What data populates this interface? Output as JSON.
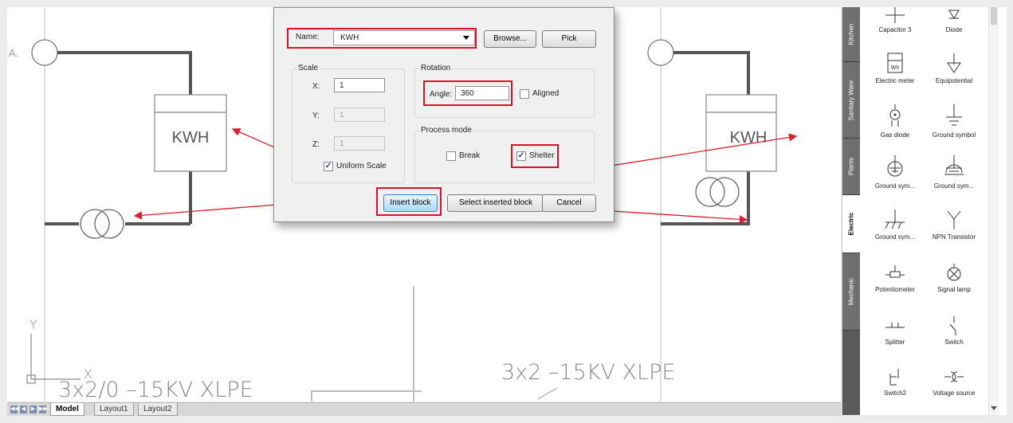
{
  "canvas": {
    "left_cable_label": "3x2/0 –15KV XLPE",
    "right_cable_label": "3x2 –15KV XLPE",
    "meter_label": "KWH",
    "axis_y": "Y",
    "axis_x": "X",
    "edge_letter": "A."
  },
  "layout_tabs": {
    "nav": [
      "◀◀",
      "◀",
      "▶",
      "▶▶"
    ],
    "tabs": [
      "Model",
      "Layout1",
      "Layout2"
    ],
    "active": "Model"
  },
  "dialog": {
    "name_label": "Name:",
    "name_value": "KWH",
    "browse_label": "Browse...",
    "pick_label": "Pick",
    "scale": {
      "title": "Scale",
      "x_label": "X:",
      "x_value": "1",
      "y_label": "Y:",
      "y_value": "1",
      "z_label": "Z:",
      "z_value": "1",
      "uniform_label": "Uniform Scale",
      "uniform_checked": true
    },
    "rotation": {
      "title": "Rotation",
      "angle_label": "Angle:",
      "angle_value": "360",
      "aligned_label": "Aligned",
      "aligned_checked": false
    },
    "process": {
      "title": "Process mode",
      "break_label": "Break",
      "break_checked": false,
      "shelter_label": "Shelter",
      "shelter_checked": true
    },
    "insert_label": "Insert block",
    "select_label": "Select inserted block",
    "cancel_label": "Cancel",
    "highlight_color": "#e0102a"
  },
  "palette": {
    "tabs": [
      "Kitchen",
      "Sanitary Ware",
      "Plants",
      "Electric",
      "Mechanic"
    ],
    "active_tab": "Electric",
    "items": [
      {
        "label": "Capacitor 3",
        "icon": "capacitor-icon"
      },
      {
        "label": "Diode",
        "icon": "diode-icon"
      },
      {
        "label": "Electric meter",
        "icon": "electric-meter-icon",
        "glyph": "Wh"
      },
      {
        "label": "Equipotential",
        "icon": "equipotential-icon"
      },
      {
        "label": "Gas diode",
        "icon": "gas-diode-icon"
      },
      {
        "label": "Ground symbol",
        "icon": "ground-symbol-icon"
      },
      {
        "label": "Ground sym...",
        "icon": "ground-circle-icon"
      },
      {
        "label": "Ground sym...",
        "icon": "ground-dome-icon"
      },
      {
        "label": "Ground sym...",
        "icon": "ground-chassis-icon"
      },
      {
        "label": "NPN Transistor",
        "icon": "npn-transistor-icon"
      },
      {
        "label": "Potentiometer",
        "icon": "potentiometer-icon"
      },
      {
        "label": "Signal lamp",
        "icon": "signal-lamp-icon"
      },
      {
        "label": "Splitter",
        "icon": "splitter-icon"
      },
      {
        "label": "Switch",
        "icon": "switch-icon"
      },
      {
        "label": "Switch2",
        "icon": "switch2-icon"
      },
      {
        "label": "Voltage source",
        "icon": "voltage-source-icon"
      }
    ]
  }
}
